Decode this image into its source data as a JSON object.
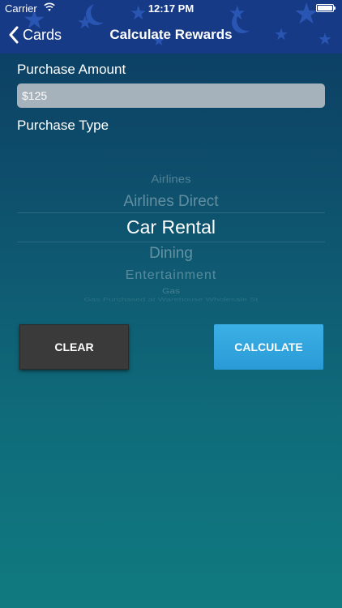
{
  "status_bar": {
    "carrier": "Carrier",
    "time": "12:17 PM",
    "wifi_icon": "wifi-icon",
    "battery_level": 1.0
  },
  "nav": {
    "back_label": "Cards",
    "title": "Calculate Rewards",
    "back_icon": "chevron-left-icon"
  },
  "form": {
    "purchase_amount_label": "Purchase Amount",
    "purchase_amount_value": "$125",
    "purchase_type_label": "Purchase Type"
  },
  "picker": {
    "items": [
      "Airlines",
      "Airlines Direct",
      "Car Rental",
      "Dining",
      "Entertainment",
      "Gas",
      "Gas Purchased at Warehouse Wholesale St"
    ],
    "selected": "Car Rental"
  },
  "buttons": {
    "clear_label": "CLEAR",
    "calculate_label": "CALCULATE"
  },
  "colors": {
    "header": "#173a86",
    "calculate_button": "#2fa6df",
    "clear_button": "#3a3a3a"
  }
}
